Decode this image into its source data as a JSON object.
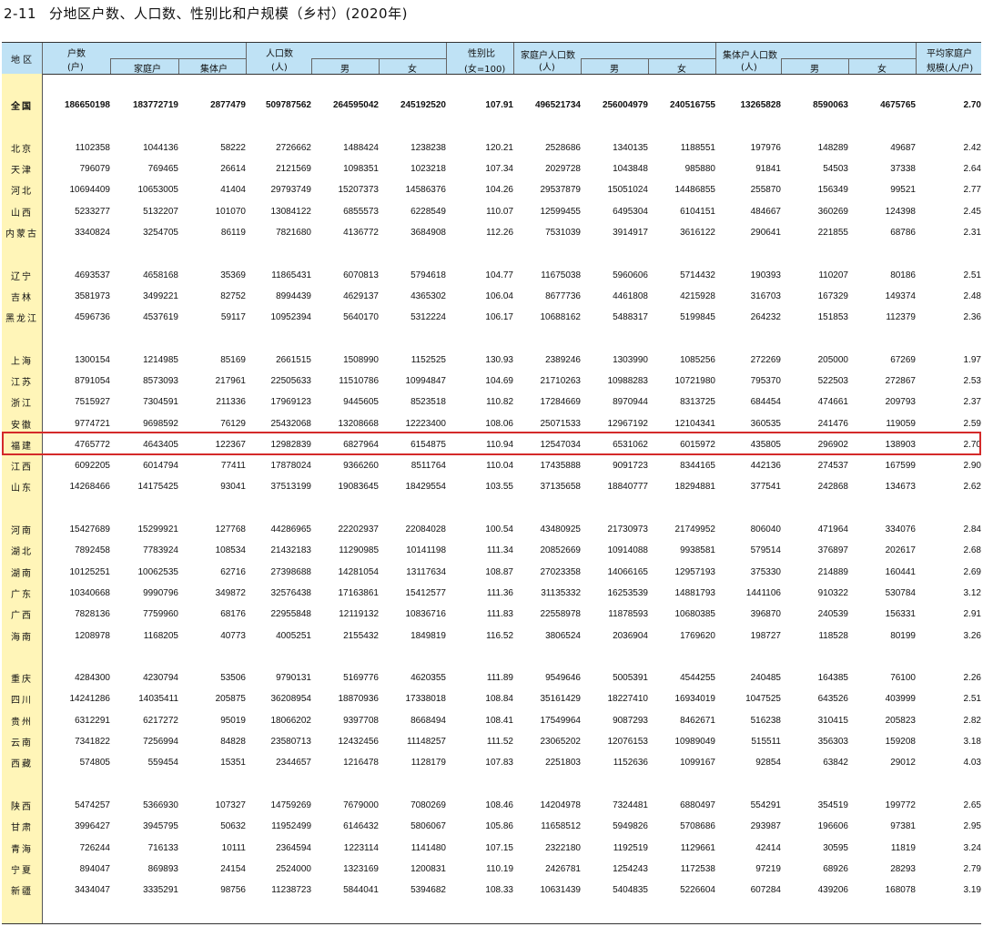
{
  "title": {
    "number": "2-11",
    "text": "分地区户数、人口数、性别比和户规模（乡村）(2020年)"
  },
  "header": {
    "region": "地 区",
    "households": "户数",
    "households_unit": "(户)",
    "family_households": "家庭户",
    "collective_households": "集体户",
    "population": "人口数",
    "population_unit": "(人)",
    "male": "男",
    "female": "女",
    "sex_ratio": "性别比",
    "sex_ratio_unit": "(女=100)",
    "family_population": "家庭户人口数",
    "family_population_unit": "(人)",
    "collective_population": "集体户人口数",
    "collective_population_unit": "(人)",
    "avg_size": "平均家庭户",
    "avg_size_unit": "规模(人/户)"
  },
  "rows": [
    {
      "name": "全国",
      "v": [
        "186650198",
        "183772719",
        "2877479",
        "509787562",
        "264595042",
        "245192520",
        "107.91",
        "496521734",
        "256004979",
        "240516755",
        "13265828",
        "8590063",
        "4675765",
        "2.70"
      ],
      "total": true
    },
    {
      "gap": true
    },
    {
      "name": "北京",
      "v": [
        "1102358",
        "1044136",
        "58222",
        "2726662",
        "1488424",
        "1238238",
        "120.21",
        "2528686",
        "1340135",
        "1188551",
        "197976",
        "148289",
        "49687",
        "2.42"
      ]
    },
    {
      "name": "天津",
      "v": [
        "796079",
        "769465",
        "26614",
        "2121569",
        "1098351",
        "1023218",
        "107.34",
        "2029728",
        "1043848",
        "985880",
        "91841",
        "54503",
        "37338",
        "2.64"
      ]
    },
    {
      "name": "河北",
      "v": [
        "10694409",
        "10653005",
        "41404",
        "29793749",
        "15207373",
        "14586376",
        "104.26",
        "29537879",
        "15051024",
        "14486855",
        "255870",
        "156349",
        "99521",
        "2.77"
      ]
    },
    {
      "name": "山西",
      "v": [
        "5233277",
        "5132207",
        "101070",
        "13084122",
        "6855573",
        "6228549",
        "110.07",
        "12599455",
        "6495304",
        "6104151",
        "484667",
        "360269",
        "124398",
        "2.45"
      ]
    },
    {
      "name": "内蒙古",
      "v": [
        "3340824",
        "3254705",
        "86119",
        "7821680",
        "4136772",
        "3684908",
        "112.26",
        "7531039",
        "3914917",
        "3616122",
        "290641",
        "221855",
        "68786",
        "2.31"
      ]
    },
    {
      "gap": true
    },
    {
      "name": "辽宁",
      "v": [
        "4693537",
        "4658168",
        "35369",
        "11865431",
        "6070813",
        "5794618",
        "104.77",
        "11675038",
        "5960606",
        "5714432",
        "190393",
        "110207",
        "80186",
        "2.51"
      ]
    },
    {
      "name": "吉林",
      "v": [
        "3581973",
        "3499221",
        "82752",
        "8994439",
        "4629137",
        "4365302",
        "106.04",
        "8677736",
        "4461808",
        "4215928",
        "316703",
        "167329",
        "149374",
        "2.48"
      ]
    },
    {
      "name": "黑龙江",
      "v": [
        "4596736",
        "4537619",
        "59117",
        "10952394",
        "5640170",
        "5312224",
        "106.17",
        "10688162",
        "5488317",
        "5199845",
        "264232",
        "151853",
        "112379",
        "2.36"
      ]
    },
    {
      "gap": true
    },
    {
      "name": "上海",
      "v": [
        "1300154",
        "1214985",
        "85169",
        "2661515",
        "1508990",
        "1152525",
        "130.93",
        "2389246",
        "1303990",
        "1085256",
        "272269",
        "205000",
        "67269",
        "1.97"
      ]
    },
    {
      "name": "江苏",
      "v": [
        "8791054",
        "8573093",
        "217961",
        "22505633",
        "11510786",
        "10994847",
        "104.69",
        "21710263",
        "10988283",
        "10721980",
        "795370",
        "522503",
        "272867",
        "2.53"
      ]
    },
    {
      "name": "浙江",
      "v": [
        "7515927",
        "7304591",
        "211336",
        "17969123",
        "9445605",
        "8523518",
        "110.82",
        "17284669",
        "8970944",
        "8313725",
        "684454",
        "474661",
        "209793",
        "2.37"
      ]
    },
    {
      "name": "安徽",
      "v": [
        "9774721",
        "9698592",
        "76129",
        "25432068",
        "13208668",
        "12223400",
        "108.06",
        "25071533",
        "12967192",
        "12104341",
        "360535",
        "241476",
        "119059",
        "2.59"
      ]
    },
    {
      "name": "福建",
      "v": [
        "4765772",
        "4643405",
        "122367",
        "12982839",
        "6827964",
        "6154875",
        "110.94",
        "12547034",
        "6531062",
        "6015972",
        "435805",
        "296902",
        "138903",
        "2.70"
      ]
    },
    {
      "name": "江西",
      "v": [
        "6092205",
        "6014794",
        "77411",
        "17878024",
        "9366260",
        "8511764",
        "110.04",
        "17435888",
        "9091723",
        "8344165",
        "442136",
        "274537",
        "167599",
        "2.90"
      ]
    },
    {
      "name": "山东",
      "v": [
        "14268466",
        "14175425",
        "93041",
        "37513199",
        "19083645",
        "18429554",
        "103.55",
        "37135658",
        "18840777",
        "18294881",
        "377541",
        "242868",
        "134673",
        "2.62"
      ]
    },
    {
      "gap": true
    },
    {
      "name": "河南",
      "v": [
        "15427689",
        "15299921",
        "127768",
        "44286965",
        "22202937",
        "22084028",
        "100.54",
        "43480925",
        "21730973",
        "21749952",
        "806040",
        "471964",
        "334076",
        "2.84"
      ]
    },
    {
      "name": "湖北",
      "v": [
        "7892458",
        "7783924",
        "108534",
        "21432183",
        "11290985",
        "10141198",
        "111.34",
        "20852669",
        "10914088",
        "9938581",
        "579514",
        "376897",
        "202617",
        "2.68"
      ]
    },
    {
      "name": "湖南",
      "v": [
        "10125251",
        "10062535",
        "62716",
        "27398688",
        "14281054",
        "13117634",
        "108.87",
        "27023358",
        "14066165",
        "12957193",
        "375330",
        "214889",
        "160441",
        "2.69"
      ]
    },
    {
      "name": "广东",
      "v": [
        "10340668",
        "9990796",
        "349872",
        "32576438",
        "17163861",
        "15412577",
        "111.36",
        "31135332",
        "16253539",
        "14881793",
        "1441106",
        "910322",
        "530784",
        "3.12"
      ]
    },
    {
      "name": "广西",
      "v": [
        "7828136",
        "7759960",
        "68176",
        "22955848",
        "12119132",
        "10836716",
        "111.83",
        "22558978",
        "11878593",
        "10680385",
        "396870",
        "240539",
        "156331",
        "2.91"
      ]
    },
    {
      "name": "海南",
      "v": [
        "1208978",
        "1168205",
        "40773",
        "4005251",
        "2155432",
        "1849819",
        "116.52",
        "3806524",
        "2036904",
        "1769620",
        "198727",
        "118528",
        "80199",
        "3.26"
      ]
    },
    {
      "gap": true
    },
    {
      "name": "重庆",
      "v": [
        "4284300",
        "4230794",
        "53506",
        "9790131",
        "5169776",
        "4620355",
        "111.89",
        "9549646",
        "5005391",
        "4544255",
        "240485",
        "164385",
        "76100",
        "2.26"
      ]
    },
    {
      "name": "四川",
      "v": [
        "14241286",
        "14035411",
        "205875",
        "36208954",
        "18870936",
        "17338018",
        "108.84",
        "35161429",
        "18227410",
        "16934019",
        "1047525",
        "643526",
        "403999",
        "2.51"
      ]
    },
    {
      "name": "贵州",
      "v": [
        "6312291",
        "6217272",
        "95019",
        "18066202",
        "9397708",
        "8668494",
        "108.41",
        "17549964",
        "9087293",
        "8462671",
        "516238",
        "310415",
        "205823",
        "2.82"
      ]
    },
    {
      "name": "云南",
      "v": [
        "7341822",
        "7256994",
        "84828",
        "23580713",
        "12432456",
        "11148257",
        "111.52",
        "23065202",
        "12076153",
        "10989049",
        "515511",
        "356303",
        "159208",
        "3.18"
      ]
    },
    {
      "name": "西藏",
      "v": [
        "574805",
        "559454",
        "15351",
        "2344657",
        "1216478",
        "1128179",
        "107.83",
        "2251803",
        "1152636",
        "1099167",
        "92854",
        "63842",
        "29012",
        "4.03"
      ]
    },
    {
      "gap": true
    },
    {
      "name": "陕西",
      "v": [
        "5474257",
        "5366930",
        "107327",
        "14759269",
        "7679000",
        "7080269",
        "108.46",
        "14204978",
        "7324481",
        "6880497",
        "554291",
        "354519",
        "199772",
        "2.65"
      ]
    },
    {
      "name": "甘肃",
      "v": [
        "3996427",
        "3945795",
        "50632",
        "11952499",
        "6146432",
        "5806067",
        "105.86",
        "11658512",
        "5949826",
        "5708686",
        "293987",
        "196606",
        "97381",
        "2.95"
      ]
    },
    {
      "name": "青海",
      "v": [
        "726244",
        "716133",
        "10111",
        "2364594",
        "1223114",
        "1141480",
        "107.15",
        "2322180",
        "1192519",
        "1129661",
        "42414",
        "30595",
        "11819",
        "3.24"
      ]
    },
    {
      "name": "宁夏",
      "v": [
        "894047",
        "869893",
        "24154",
        "2524000",
        "1323169",
        "1200831",
        "110.19",
        "2426781",
        "1254243",
        "1172538",
        "97219",
        "68926",
        "28293",
        "2.79"
      ]
    },
    {
      "name": "新疆",
      "v": [
        "3434047",
        "3335291",
        "98756",
        "11238723",
        "5844041",
        "5394682",
        "108.33",
        "10631439",
        "5404835",
        "5226604",
        "607284",
        "439206",
        "168078",
        "3.19"
      ]
    }
  ]
}
